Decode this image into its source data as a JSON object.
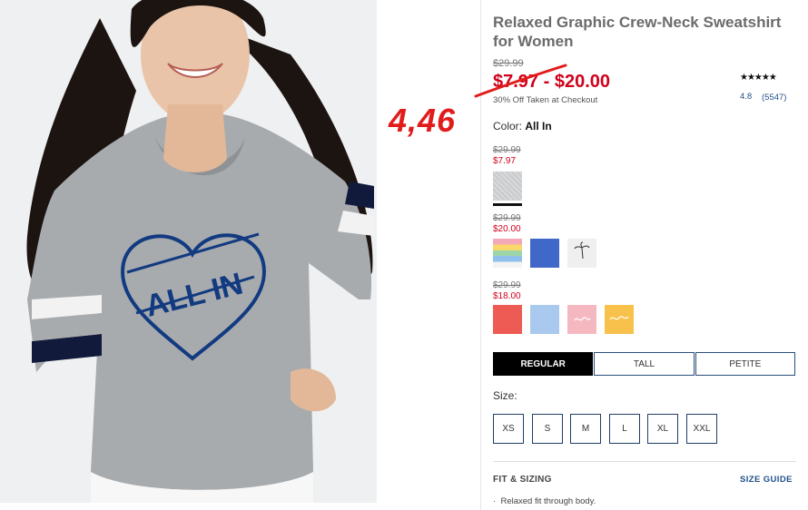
{
  "product": {
    "title": "Relaxed Graphic Crew-Neck Sweatshirt for Women",
    "original_price": "$29.99",
    "sale_price": "$7.97 - $20.00",
    "promo_text": "30% Off Taken at Checkout",
    "rating": {
      "stars": "★★★★★",
      "value": "4.8",
      "count": "(5547)"
    }
  },
  "annotation": {
    "text": "4,46",
    "color": "#e21b1b"
  },
  "graphic": {
    "print_text": "ALL IN"
  },
  "color": {
    "label": "Color:",
    "selected": "All In",
    "groups": [
      {
        "was": "$29.99",
        "now": "$7.97",
        "swatches": [
          "heather-gray"
        ]
      },
      {
        "was": "$29.99",
        "now": "$20.00",
        "swatches": [
          "rainbow-stripe",
          "royal-blue",
          "palm-tree-white"
        ]
      },
      {
        "was": "$29.99",
        "now": "$18.00",
        "swatches": [
          "coral-red",
          "light-blue",
          "pink-script",
          "yellow-script"
        ]
      }
    ]
  },
  "fit": {
    "tabs": [
      {
        "label": "REGULAR",
        "active": true
      },
      {
        "label": "TALL",
        "active": false
      },
      {
        "label": "PETITE",
        "active": false
      }
    ]
  },
  "size": {
    "label": "Size:",
    "options": [
      "XS",
      "S",
      "M",
      "L",
      "XL",
      "XXL"
    ]
  },
  "fit_sizing": {
    "heading": "FIT & SIZING",
    "size_guide": "SIZE GUIDE",
    "bullets": [
      "Relaxed fit through body."
    ]
  },
  "colors": {
    "sale_red": "#d0021b",
    "link_blue": "#1f4f8a",
    "active_tab": "#000000"
  }
}
